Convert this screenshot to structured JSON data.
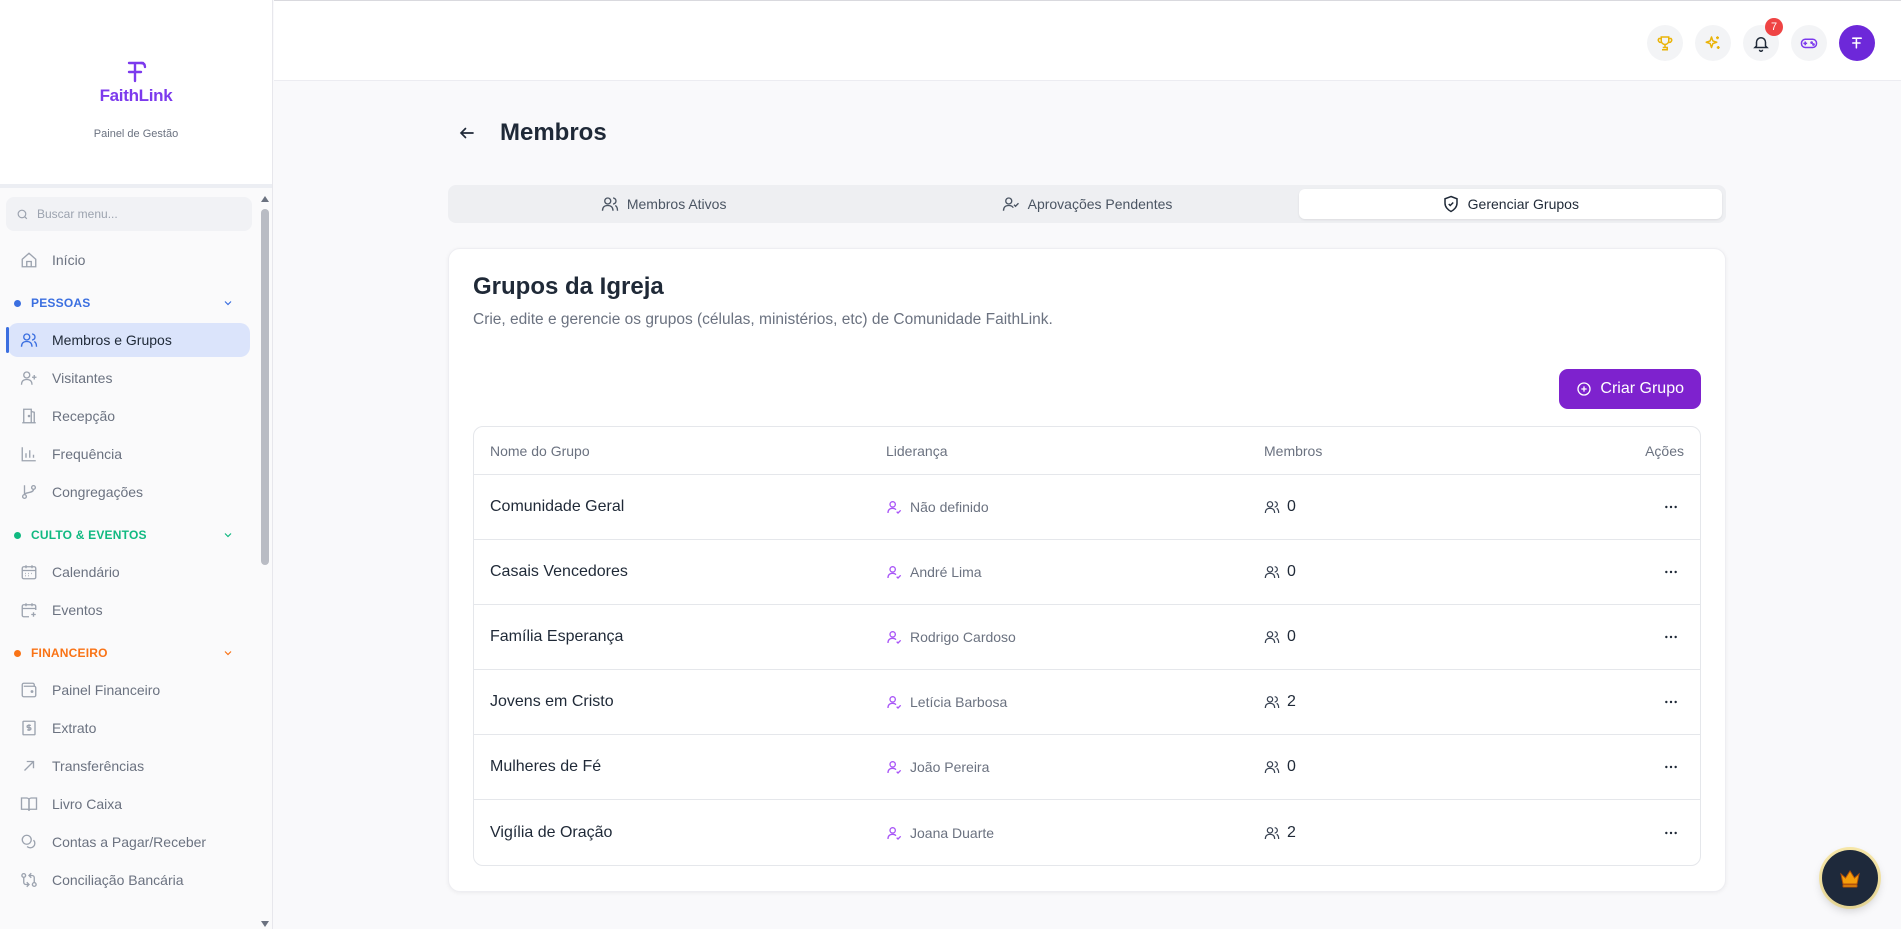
{
  "brand": {
    "name": "FaithLink",
    "subtitle": "Painel de Gestão"
  },
  "sidebar": {
    "search_placeholder": "Buscar menu...",
    "home": "Início",
    "sections": [
      {
        "label": "PESSOAS",
        "color": "#3b6fe0",
        "items": [
          "Membros e Grupos",
          "Visitantes",
          "Recepção",
          "Frequência",
          "Congregações"
        ]
      },
      {
        "label": "CULTO & EVENTOS",
        "color": "#10b981",
        "items": [
          "Calendário",
          "Eventos"
        ]
      },
      {
        "label": "FINANCEIRO",
        "color": "#f97316",
        "items": [
          "Painel Financeiro",
          "Extrato",
          "Transferências",
          "Livro Caixa",
          "Contas a Pagar/Receber",
          "Conciliação Bancária"
        ]
      }
    ]
  },
  "topbar": {
    "notification_count": "7"
  },
  "page": {
    "title": "Membros"
  },
  "tabs": [
    {
      "label": "Membros Ativos",
      "icon": "users-icon"
    },
    {
      "label": "Aprovações Pendentes",
      "icon": "user-check-icon"
    },
    {
      "label": "Gerenciar Grupos",
      "icon": "shield-check-icon",
      "active": true
    }
  ],
  "card": {
    "title": "Grupos da Igreja",
    "description": "Crie, edite e gerencie os grupos (células, ministérios, etc) de Comunidade FaithLink.",
    "create_button": "Criar Grupo"
  },
  "table": {
    "headers": [
      "Nome do Grupo",
      "Liderança",
      "Membros",
      "Ações"
    ],
    "rows": [
      {
        "name": "Comunidade Geral",
        "leader": "Não definido",
        "members": "0"
      },
      {
        "name": "Casais Vencedores",
        "leader": "André Lima",
        "members": "0"
      },
      {
        "name": "Família Esperança",
        "leader": "Rodrigo Cardoso",
        "members": "0"
      },
      {
        "name": "Jovens em Cristo",
        "leader": "Letícia Barbosa",
        "members": "2"
      },
      {
        "name": "Mulheres de Fé",
        "leader": "João Pereira",
        "members": "0"
      },
      {
        "name": "Vigília de Oração",
        "leader": "Joana Duarte",
        "members": "2"
      }
    ]
  },
  "colors": {
    "accent": "#7e22ce",
    "active_nav": "#dbe4fb",
    "badge": "#ef4444"
  }
}
